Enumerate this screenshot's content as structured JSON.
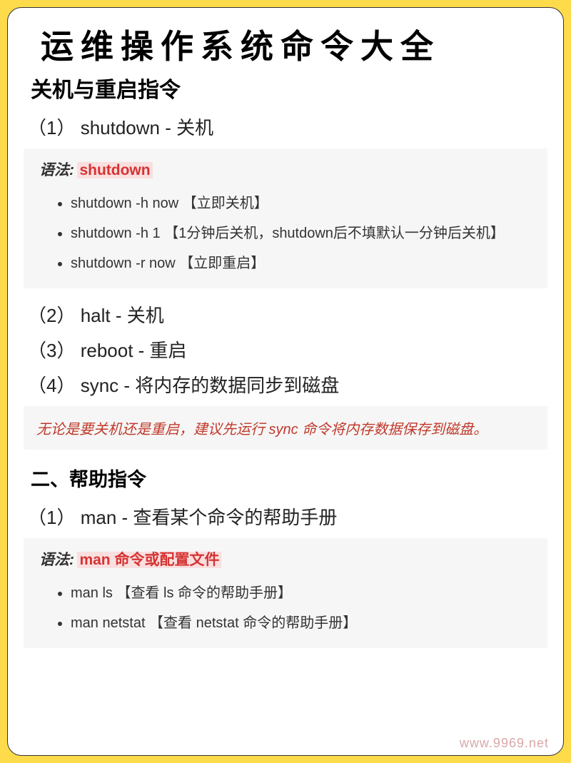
{
  "title": "运维操作系统命令大全",
  "section1": {
    "heading": "关机与重启指令",
    "items": [
      {
        "num": "（1）",
        "text": "shutdown - 关机"
      },
      {
        "num": "（2）",
        "text": "halt - 关机"
      },
      {
        "num": "（3）",
        "text": "reboot - 重启"
      },
      {
        "num": "（4）",
        "text": "sync - 将内存的数据同步到磁盘"
      }
    ],
    "syntax_label": "语法:",
    "syntax_cmd": "shutdown",
    "bullets": [
      "shutdown -h now 【立即关机】",
      "shutdown -h 1 【1分钟后关机，shutdown后不填默认一分钟后关机】",
      "shutdown -r now 【立即重启】"
    ],
    "note": "无论是要关机还是重启，建议先运行 sync 命令将内存数据保存到磁盘。"
  },
  "section2": {
    "heading": "二、帮助指令",
    "items": [
      {
        "num": "（1）",
        "text": "man - 查看某个命令的帮助手册"
      }
    ],
    "syntax_label": "语法:",
    "syntax_cmd": "man 命令或配置文件",
    "bullets": [
      "man ls 【查看 ls 命令的帮助手册】",
      "man netstat 【查看 netstat 命令的帮助手册】"
    ]
  },
  "watermark": "www.9969.net"
}
